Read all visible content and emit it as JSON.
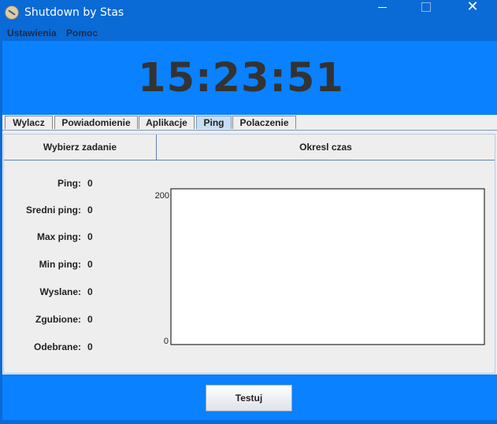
{
  "window": {
    "title": "Shutdown by Stas",
    "icon": "app-icon",
    "controls": [
      "minimize-icon",
      "maximize-icon",
      "close-icon"
    ]
  },
  "menu": {
    "items": [
      "Ustawienia",
      "Pomoc"
    ]
  },
  "clock": {
    "time": "15:23:51"
  },
  "tabs": {
    "items": [
      "Wylacz",
      "Powiadomienie",
      "Aplikacje",
      "Ping",
      "Polaczenie"
    ],
    "active": "Ping"
  },
  "panel": {
    "left_header": "Wybierz zadanie",
    "right_header": "Okresl czas",
    "stats": [
      {
        "label": "Ping:",
        "value": "0"
      },
      {
        "label": "Sredni ping:",
        "value": "0"
      },
      {
        "label": "Max ping:",
        "value": "0"
      },
      {
        "label": "Min ping:",
        "value": "0"
      },
      {
        "label": "Wyslane:",
        "value": "0"
      },
      {
        "label": "Zgubione:",
        "value": "0"
      },
      {
        "label": "Odebrane:",
        "value": "0"
      }
    ]
  },
  "chart_data": {
    "type": "line",
    "ylim": [
      0,
      200
    ],
    "yticks": [
      "200",
      "0"
    ],
    "series": []
  },
  "actions": {
    "test_label": "Testuj"
  },
  "colors": {
    "titlebar": "#0a6ad6",
    "accent": "#0a81ff",
    "panel_bg": "#eeeeee",
    "active_tab": "#c8ddf2"
  }
}
